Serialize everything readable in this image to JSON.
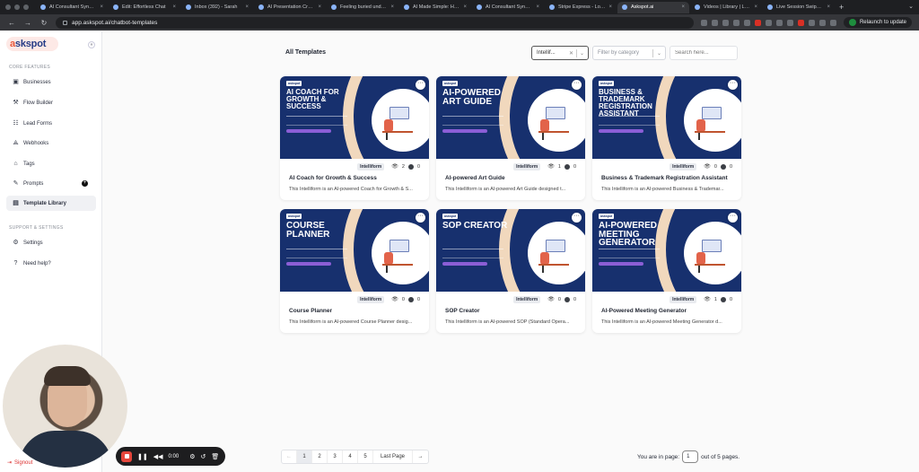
{
  "browser": {
    "tabs": [
      "AI Consultant Syndicate",
      "Edit: Effortless Chat",
      "Inbox (392) - Sarah",
      "AI Presentation Creator",
      "Feeling buried under d",
      "AI Made Simple: How S",
      "AI Consultant Syndicate",
      "Stripe Express - Login",
      "Askspot.ai",
      "Videos | Library | Loom",
      "Live Session Swipe - G"
    ],
    "active_tab_index": 8,
    "url": "app.askspot.ai/chatbot-templates",
    "relaunch_label": "Relaunch to update"
  },
  "sidebar": {
    "logo": {
      "accent": "a",
      "rest": "skspot"
    },
    "collapse_icon": "«",
    "core_label": "CORE FEATURES",
    "items": [
      {
        "label": "Businesses",
        "icon": "briefcase-icon",
        "glyph": "▣"
      },
      {
        "label": "Flow Builder",
        "icon": "flow-icon",
        "glyph": "⚒"
      },
      {
        "label": "Lead Forms",
        "icon": "form-icon",
        "glyph": "☷"
      },
      {
        "label": "Webhooks",
        "icon": "webhook-icon",
        "glyph": "⟁"
      },
      {
        "label": "Tags",
        "icon": "tag-icon",
        "glyph": "⌂"
      },
      {
        "label": "Prompts",
        "icon": "prompt-icon",
        "glyph": "✎"
      },
      {
        "label": "Template Library",
        "icon": "library-icon",
        "glyph": "▤"
      }
    ],
    "support_label": "SUPPORT & SETTINGS",
    "support_items": [
      {
        "label": "Settings",
        "icon": "gear-icon",
        "glyph": "⚙"
      },
      {
        "label": "Need help?",
        "icon": "help-icon",
        "glyph": "?"
      }
    ],
    "signout_label": "Signout"
  },
  "main": {
    "title": "All Templates",
    "type_filter_value": "Intellif...",
    "category_placeholder": "Filter by category",
    "search_placeholder": "Search here...",
    "cards": [
      {
        "banner_title": "AI COACH FOR GROWTH & SUCCESS",
        "badge": "Intelliform",
        "views": "2",
        "downloads": "0",
        "title": "AI Coach for Growth & Success",
        "desc": "This Intelliform is an AI-powered Coach for Growth & S..."
      },
      {
        "banner_title": "AI-POWERED ART GUIDE",
        "badge": "Intelliform",
        "views": "1",
        "downloads": "0",
        "title": "AI-powered Art Guide",
        "desc": "This Intelliform is an AI-powered Art Guide designed t..."
      },
      {
        "banner_title": "BUSINESS & TRADEMARK REGISTRATION ASSISTANT",
        "badge": "Intelliform",
        "views": "0",
        "downloads": "0",
        "title": "Business & Trademark Registration Assistant",
        "desc": "This Intelliform is an AI-powered Business & Trademar..."
      },
      {
        "banner_title": "COURSE PLANNER",
        "badge": "Intelliform",
        "views": "0",
        "downloads": "0",
        "title": "Course Planner",
        "desc": "This Intelliform is an AI-powered Course Planner desig..."
      },
      {
        "banner_title": "SOP CREATOR",
        "badge": "Intelliform",
        "views": "0",
        "downloads": "0",
        "title": "SOP Creator",
        "desc": "This Intelliform is an AI-powered SOP (Standard Opera..."
      },
      {
        "banner_title": "AI-POWERED MEETING GENERATOR",
        "badge": "Intelliform",
        "views": "1",
        "downloads": "0",
        "title": "AI-Powered Meeting Generator",
        "desc": "This Intelliform is an AI-powered Meeting Generator d..."
      }
    ]
  },
  "pagination": {
    "prev": "←",
    "pages": [
      "1",
      "2",
      "3",
      "4",
      "5"
    ],
    "current": "1",
    "last_label": "Last Page",
    "next": "→",
    "info_prefix": "You are in page:",
    "info_value": "1",
    "info_suffix": "out of 5 pages."
  },
  "recorder": {
    "time": "0:00"
  },
  "colors": {
    "banner_navy": "#17306e",
    "banner_cream": "#f1d8bd",
    "logo_bg": "#fde9e6",
    "logo_accent": "#e85a3c",
    "record_red": "#e5463b"
  }
}
